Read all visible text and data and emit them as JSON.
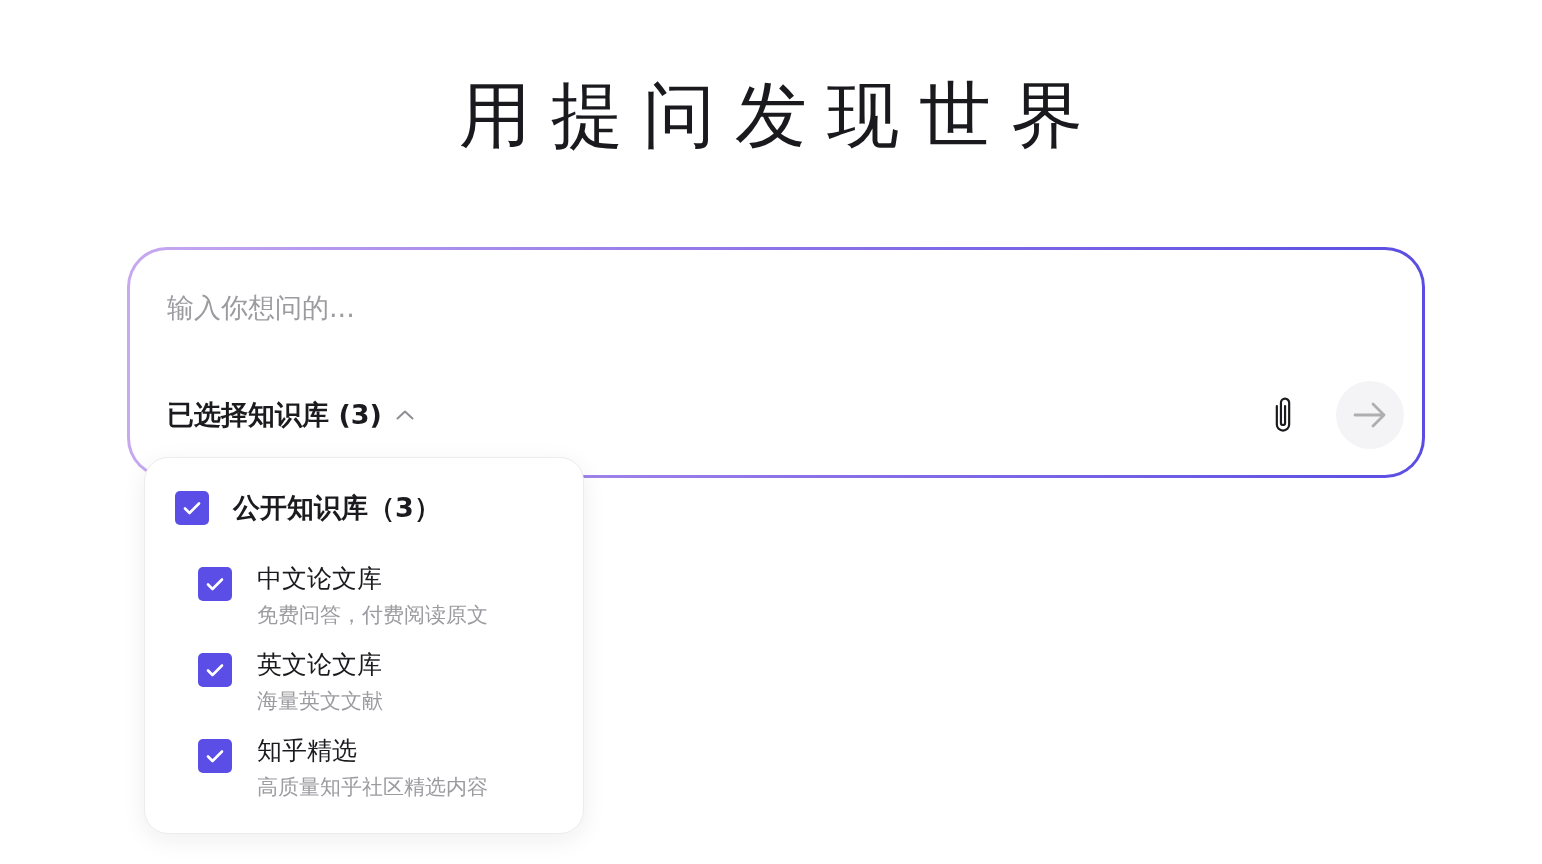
{
  "title": "用提问发现世界",
  "question_input": {
    "placeholder": "输入你想问的..."
  },
  "knowledge_selector": {
    "label": "已选择知识库 (3)",
    "expanded": true
  },
  "send_button": {
    "disabled": true
  },
  "knowledge_menu": {
    "groups": [
      {
        "label": "公开知识库（3）",
        "checked": true,
        "children": [
          {
            "label": "中文论文库",
            "description": "免费问答，付费阅读原文",
            "checked": true
          },
          {
            "label": "英文论文库",
            "description": "海量英文文献",
            "checked": true
          },
          {
            "label": "知乎精选",
            "description": "高质量知乎社区精选内容",
            "checked": true
          }
        ]
      }
    ]
  }
}
